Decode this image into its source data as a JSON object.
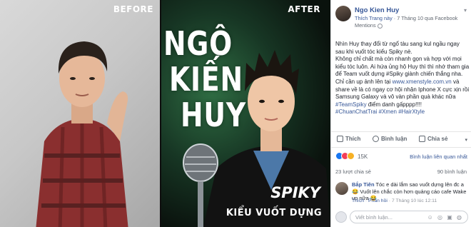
{
  "photo": {
    "before_label": "BEFORE",
    "after_label": "AFTER",
    "title_line1": "NGÔ",
    "title_line2": "KIẾN",
    "title_line3": "HUY",
    "spiky": "SPIKY",
    "spiky_sub": "KIỂU VUỐT DỰNG",
    "colors": {
      "after_bg": "#173624",
      "accent_green": "#2f6d43"
    }
  },
  "post": {
    "author": "Ngo Kien Huy",
    "meta_prefix": "Thích Trang này",
    "meta_time": "7 Tháng 10 qua Facebook",
    "meta_mentions": "Mentions",
    "body": [
      "Nhìn Huy thay đổi từ ngổ tàu sang kul ngầu ngay sau khi vuốt tóc kiểu Spiky nè.",
      "Không chỉ chất mà còn nhanh gọn và hợp với mọi kiểu tóc luôn. Ai hứa ủng hộ Huy thì thì nhớ tham gia để Team vuốt dựng #Spiky giành chiến thắng nha.",
      "Chỉ cần up ảnh lên tại ",
      "www.xmenstyle.com.vn",
      " và share về là có ngay cơ hội nhận Iphone X cực xịn rồi Samsung Galaxy và vô vàn phần quà khác nữa ",
      "#TeamSpiky",
      " điểm danh gấpppp!!!!",
      "#ChuanChatTrai #Xmen #HairXtyle"
    ],
    "actions": {
      "like": "Thích",
      "comment": "Bình luận",
      "share": "Chia sẻ"
    },
    "reactions_count": "15K",
    "sort_label": "Bình luận liên quan nhất",
    "shares": "23 lượt chia sẻ",
    "comments_total": "90 bình luận",
    "comment": {
      "author": "Bắp Tiên",
      "text": " Tóc e dài lắm sao vuốt dựng lên đc a 😂 Vuốt lên chắc còn hơn quảng cáo cafe Wake up nữa 😂",
      "like": "Thích",
      "reply": "Phản hồi",
      "time": "7 Tháng 10 lúc 12:11"
    },
    "write_placeholder": "Viết bình luận...",
    "write_icons": "☺ ◎ ▣ ◍"
  }
}
